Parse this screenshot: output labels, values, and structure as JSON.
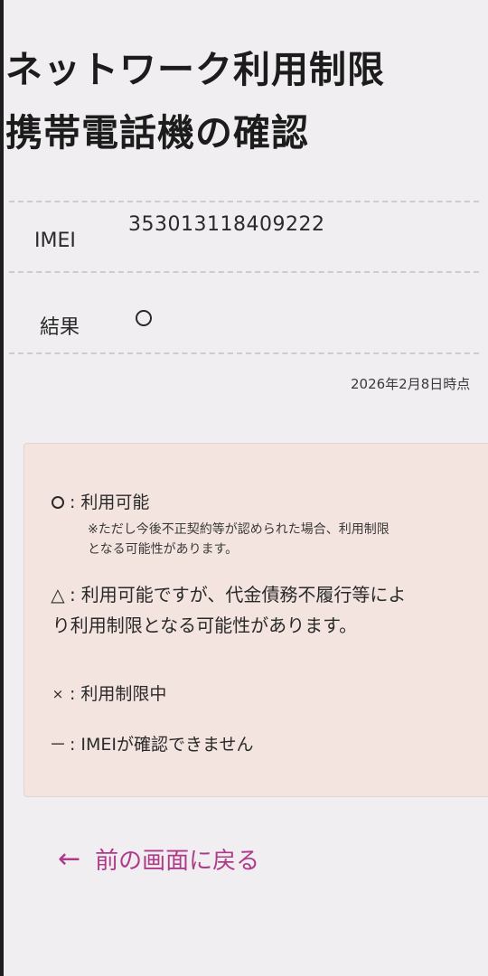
{
  "title": {
    "line1": "ネットワーク利用制限",
    "line2": "携帯電話機の確認"
  },
  "info": {
    "imei_label": "IMEI",
    "imei_value": "353013118409222",
    "result_label": "結果",
    "result_symbol": "○",
    "checked_at": "2026年2月8日時点"
  },
  "legend": {
    "items": [
      {
        "symbol": "○",
        "colon": ":",
        "text": "利用可能",
        "note_line1": "※ただし今後不正契約等が認められた場合、利用制限",
        "note_line2": "となる可能性があります。"
      },
      {
        "symbol": "△",
        "colon": ":",
        "text_line1": "利用可能ですが、代金債務不履行等によ",
        "text_line2": "り利用制限となる可能性があります。"
      },
      {
        "symbol": "×",
        "colon": ":",
        "text": "利用制限中"
      },
      {
        "symbol": "－",
        "colon": ":",
        "text": "IMEIが確認できません"
      }
    ]
  },
  "back": {
    "icon": "left-arrow-icon",
    "label": "前の画面に戻る"
  },
  "colors": {
    "accent": "#b03a8a",
    "legend_bg": "#f3e4df",
    "page_bg": "#f0eef0"
  }
}
